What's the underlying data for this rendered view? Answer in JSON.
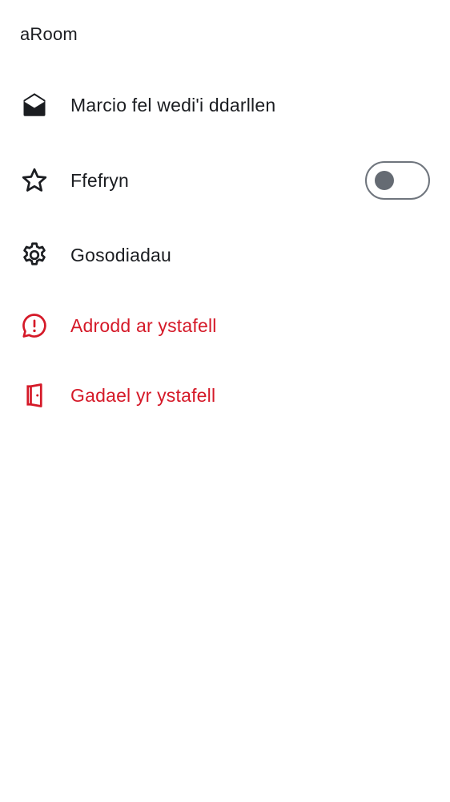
{
  "header": {
    "room_name": "aRoom"
  },
  "menu": {
    "mark_read": {
      "label": "Marcio fel wedi'i ddarllen",
      "icon": "envelope-open-icon"
    },
    "favourite": {
      "label": "Ffefryn",
      "icon": "star-icon",
      "toggle_on": false
    },
    "settings": {
      "label": "Gosodiadau",
      "icon": "gear-icon"
    },
    "report": {
      "label": "Adrodd ar ystafell",
      "icon": "chat-error-icon"
    },
    "leave": {
      "label": "Gadael yr ystafell",
      "icon": "leave-door-icon"
    }
  },
  "colors": {
    "text": "#1b1d21",
    "danger": "#d51928",
    "toggle_border": "#6f757d",
    "toggle_knob": "#656b73",
    "background": "#ffffff"
  }
}
